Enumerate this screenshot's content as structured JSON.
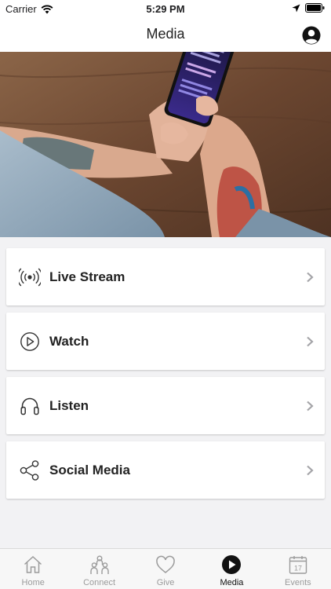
{
  "status_bar": {
    "carrier": "Carrier",
    "time": "5:29 PM"
  },
  "nav": {
    "title": "Media"
  },
  "menu": [
    {
      "label": "Live Stream",
      "icon": "live-stream-icon"
    },
    {
      "label": "Watch",
      "icon": "play-circle-icon"
    },
    {
      "label": "Listen",
      "icon": "headphones-icon"
    },
    {
      "label": "Social Media",
      "icon": "share-icon"
    }
  ],
  "tabs": [
    {
      "label": "Home",
      "icon": "home-icon",
      "active": false
    },
    {
      "label": "Connect",
      "icon": "people-icon",
      "active": false
    },
    {
      "label": "Give",
      "icon": "heart-icon",
      "active": false
    },
    {
      "label": "Media",
      "icon": "play-filled-icon",
      "active": true
    },
    {
      "label": "Events",
      "icon": "calendar-icon",
      "active": false
    }
  ],
  "calendar_day": "17",
  "colors": {
    "accent": "#111111",
    "tab_inactive": "#9b9b9b",
    "background": "#f2f2f4"
  }
}
